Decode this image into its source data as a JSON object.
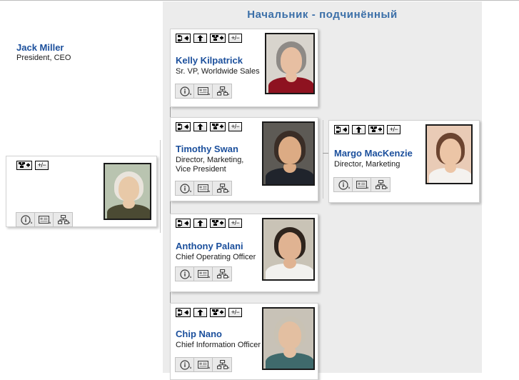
{
  "panel": {
    "title": "Начальник - подчинённый"
  },
  "toolbar_icons": {
    "prev_subordinate": "org-chart-left-arrow-icon",
    "up": "up-arrow-icon",
    "expand": "org-chart-plus-icon",
    "plus_minus_label": "+/−",
    "info": "info-circle-icon",
    "card": "contact-card-icon",
    "org": "org-chart-icon",
    "dropdown": "dropdown-arrow-icon"
  },
  "colors": {
    "panel_bg": "#ececec",
    "title_blue": "#3b6fa8",
    "name_blue": "#1b4f9c",
    "card_bg": "#ffffff",
    "connector": "#9a9a9a"
  },
  "cards": [
    {
      "id": "jack-miller",
      "name": "Jack Miller",
      "title": "President, CEO",
      "has_nav_buttons": false,
      "photo": {
        "skin": "#e8c9a8",
        "hair": "#e9e4dc",
        "cloth": "#4b4a33",
        "bg": "#b9c4b0"
      }
    },
    {
      "id": "kelly-kilpatrick",
      "name": "Kelly Kilpatrick",
      "title": "Sr. VP, Worldwide Sales",
      "has_nav_buttons": true,
      "photo": {
        "skin": "#e7bfa2",
        "hair": "#8e8a86",
        "cloth": "#8e1220",
        "bg": "#d8d4cd"
      }
    },
    {
      "id": "timothy-swan",
      "name": "Timothy Swan",
      "title": "Director, Marketing, Vice President",
      "has_nav_buttons": true,
      "photo": {
        "skin": "#dcab84",
        "hair": "#3a2d26",
        "cloth": "#20242c",
        "bg": "#5d5a55"
      }
    },
    {
      "id": "anthony-palani",
      "name": "Anthony Palani",
      "title": "Chief Operating Officer",
      "has_nav_buttons": true,
      "photo": {
        "skin": "#e0b392",
        "hair": "#2e241d",
        "cloth": "#f2f1ee",
        "bg": "#c9c3b6"
      }
    },
    {
      "id": "chip-nano",
      "name": "Chip Nano",
      "title": "Chief Information Officer",
      "has_nav_buttons": true,
      "photo": {
        "skin": "#e3bfa1",
        "hair": "#c9c2b4",
        "cloth": "#3f6a6c",
        "bg": "#c8c2b7"
      }
    },
    {
      "id": "margo-mackenzie",
      "name": "Margo MacKenzie",
      "title": "Director, Marketing",
      "has_nav_buttons": true,
      "photo": {
        "skin": "#ecc5a6",
        "hair": "#6b4430",
        "cloth": "#f4f2ef",
        "bg": "#e9cbb6"
      }
    }
  ]
}
